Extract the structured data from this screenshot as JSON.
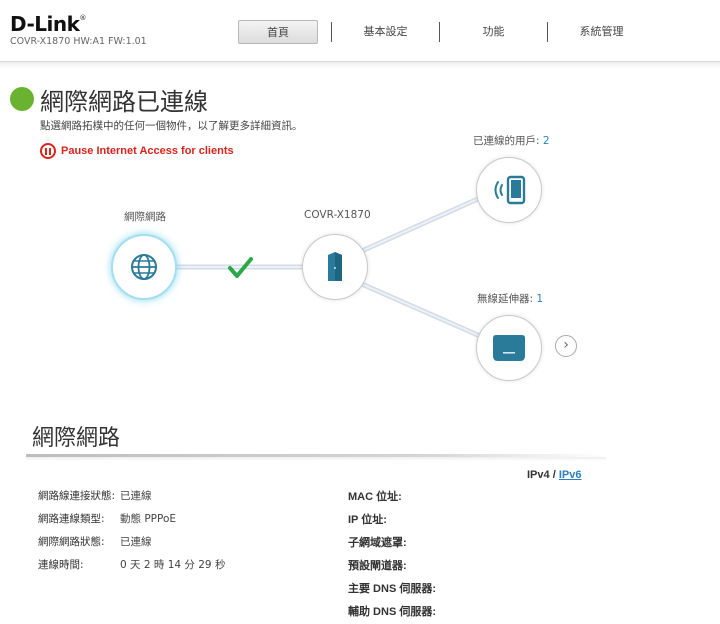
{
  "header": {
    "logo": "D-Link",
    "model_info": "COVR-X1870 HW:A1 FW:1.01"
  },
  "nav": {
    "items": [
      {
        "label": "首頁",
        "active": true
      },
      {
        "label": "基本設定",
        "active": false
      },
      {
        "label": "功能",
        "active": false
      },
      {
        "label": "系統管理",
        "active": false
      }
    ]
  },
  "status": {
    "title": "網際網路已連線",
    "subtitle": "點選網路拓樸中的任何一個物件，以了解更多詳細資訊。",
    "pause_label": "Pause Internet Access for clients",
    "status_color": "#6ab330",
    "alert_color": "#d9241c"
  },
  "topology": {
    "internet_label": "網際網路",
    "router_label": "COVR-X1870",
    "clients_label": "已連線的用戶:",
    "clients_count": "2",
    "extenders_label": "無線延伸器:",
    "extenders_count": "1",
    "link_ok_color": "#2ba84a",
    "icon_color": "#2a7a9a"
  },
  "details": {
    "section_title": "網際網路",
    "ipv4_label": "IPv4",
    "ipv_separator": "/",
    "ipv6_label": "IPv6",
    "left": [
      {
        "key": "網路線連接狀態:",
        "value": "已連線"
      },
      {
        "key": "網路連線類型:",
        "value": "動態 PPPoE"
      },
      {
        "key": "網際網路狀態:",
        "value": "已連線"
      },
      {
        "key": "連線時間:",
        "value": "0 天 2 時 14 分 29 秒"
      }
    ],
    "right": [
      {
        "key": "MAC 位址:",
        "value": ""
      },
      {
        "key": "IP 位址:",
        "value": ""
      },
      {
        "key": "子網域遮罩:",
        "value": ""
      },
      {
        "key": "預設閘道器:",
        "value": ""
      },
      {
        "key": "主要 DNS 伺服器:",
        "value": ""
      },
      {
        "key": "輔助 DNS 伺服器:",
        "value": ""
      }
    ]
  }
}
